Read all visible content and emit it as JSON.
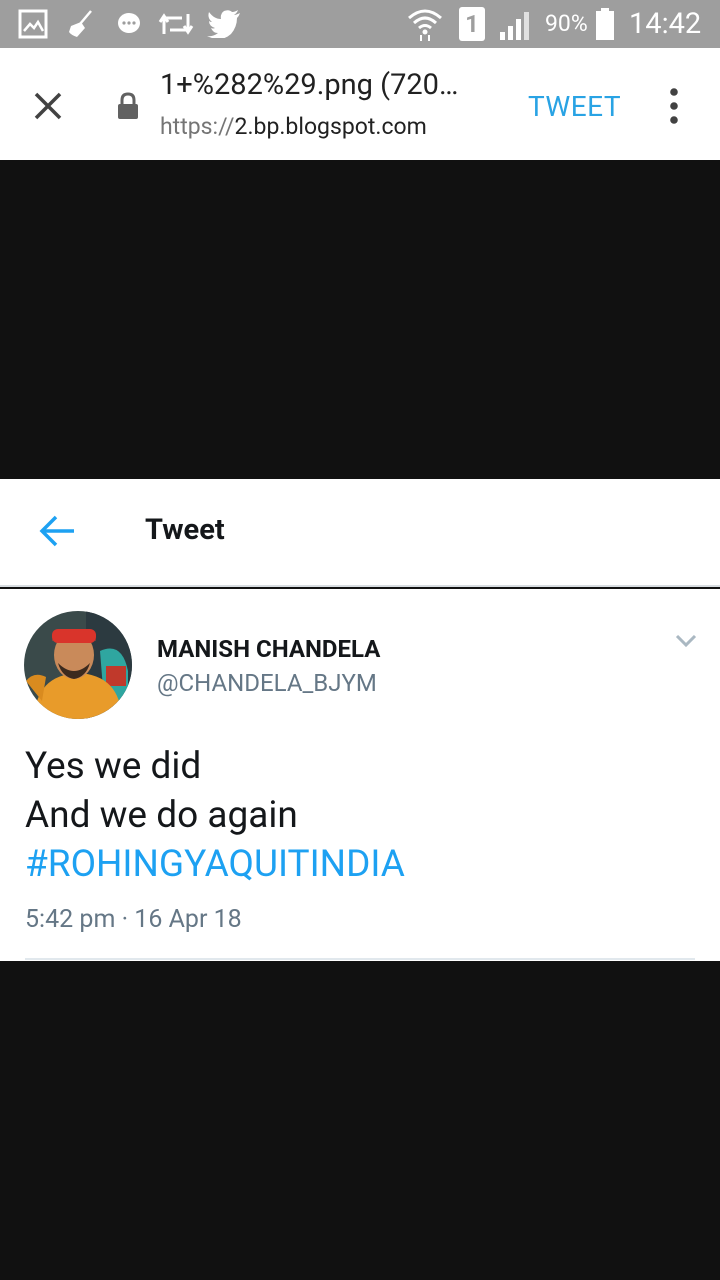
{
  "status_bar": {
    "icons": [
      "gallery-icon",
      "broom-icon",
      "message-icon",
      "retweet-icon",
      "twitter-bird-icon",
      "wifi-icon",
      "sim-1-icon",
      "signal-icon",
      "battery-icon"
    ],
    "sim_number": "1",
    "battery_percent": "90%",
    "time": "14:42"
  },
  "browser": {
    "close_icon": "close-icon",
    "lock_icon": "lock-icon",
    "page_title": "1+%282%29.png (720…",
    "url_scheme": "https://",
    "url_host": "2.bp.blogspot.com",
    "action_label": "TWEET",
    "menu_icon": "more-vert-icon"
  },
  "twitter_header": {
    "back_icon": "back-arrow-icon",
    "title": "Tweet"
  },
  "tweet": {
    "display_name": "MANISH CHANDELA",
    "handle": "@CHANDELA_BJYM",
    "lines": [
      "Yes we did",
      "And we do again"
    ],
    "hashtag": "#ROHINGYAQUITINDIA",
    "timestamp": "5:42 pm · 16 Apr 18",
    "options_icon": "chevron-down-icon"
  },
  "colors": {
    "link_blue": "#1da1f2",
    "status_bar_gray": "#9e9e9e"
  }
}
